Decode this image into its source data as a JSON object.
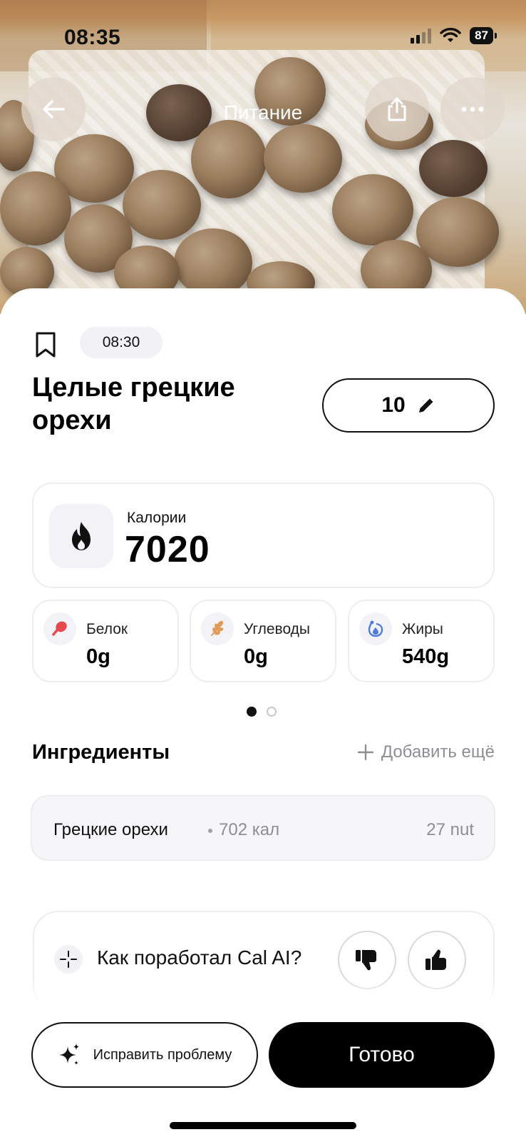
{
  "status_bar": {
    "time": "08:35",
    "battery": "87"
  },
  "nav": {
    "title": "Питание"
  },
  "meal": {
    "time": "08:30",
    "title": "Целые грецкие орехи",
    "quantity": "10"
  },
  "calories": {
    "label": "Калории",
    "value": "7020"
  },
  "macros": [
    {
      "label": "Белок",
      "value": "0g",
      "icon": "drumstick-icon",
      "color": "#e5484d"
    },
    {
      "label": "Углеводы",
      "value": "0g",
      "icon": "wheat-icon",
      "color": "#e09b59"
    },
    {
      "label": "Жиры",
      "value": "540g",
      "icon": "oil-drop-icon",
      "color": "#4f7be0"
    }
  ],
  "pager": {
    "count": 2,
    "active": 0
  },
  "ingredients": {
    "title": "Ингредиенты",
    "add_label": "Добавить ещё",
    "items": [
      {
        "name": "Грецкие орехи",
        "calories": "702 кал",
        "quantity": "27 nut"
      }
    ]
  },
  "feedback": {
    "question": "Как поработал Cal AI?"
  },
  "actions": {
    "fix_label": "Исправить проблему",
    "done_label": "Готово"
  }
}
